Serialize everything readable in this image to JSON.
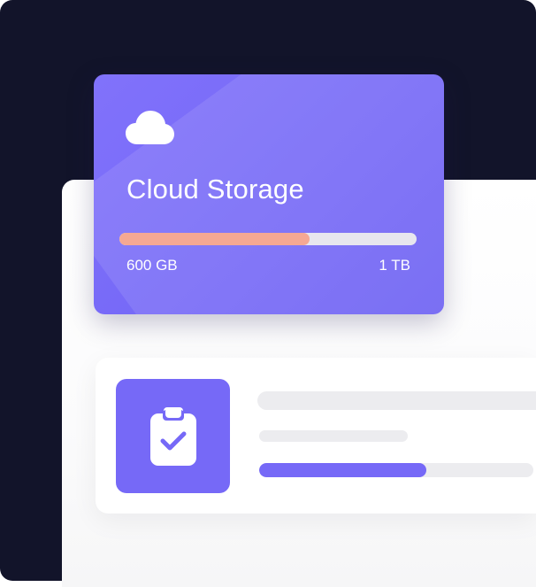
{
  "storage_card": {
    "title": "Cloud Storage",
    "used_label": "600 GB",
    "total_label": "1 TB",
    "used_fraction": 0.64,
    "icon": "cloud-icon",
    "bar_fill_color": "#f5a893",
    "card_color": "#7669f7"
  },
  "task_card": {
    "icon": "clipboard-check-icon",
    "progress_fraction": 0.61,
    "accent_color": "#7669f7"
  },
  "background": {
    "dark_color": "#12142a"
  }
}
